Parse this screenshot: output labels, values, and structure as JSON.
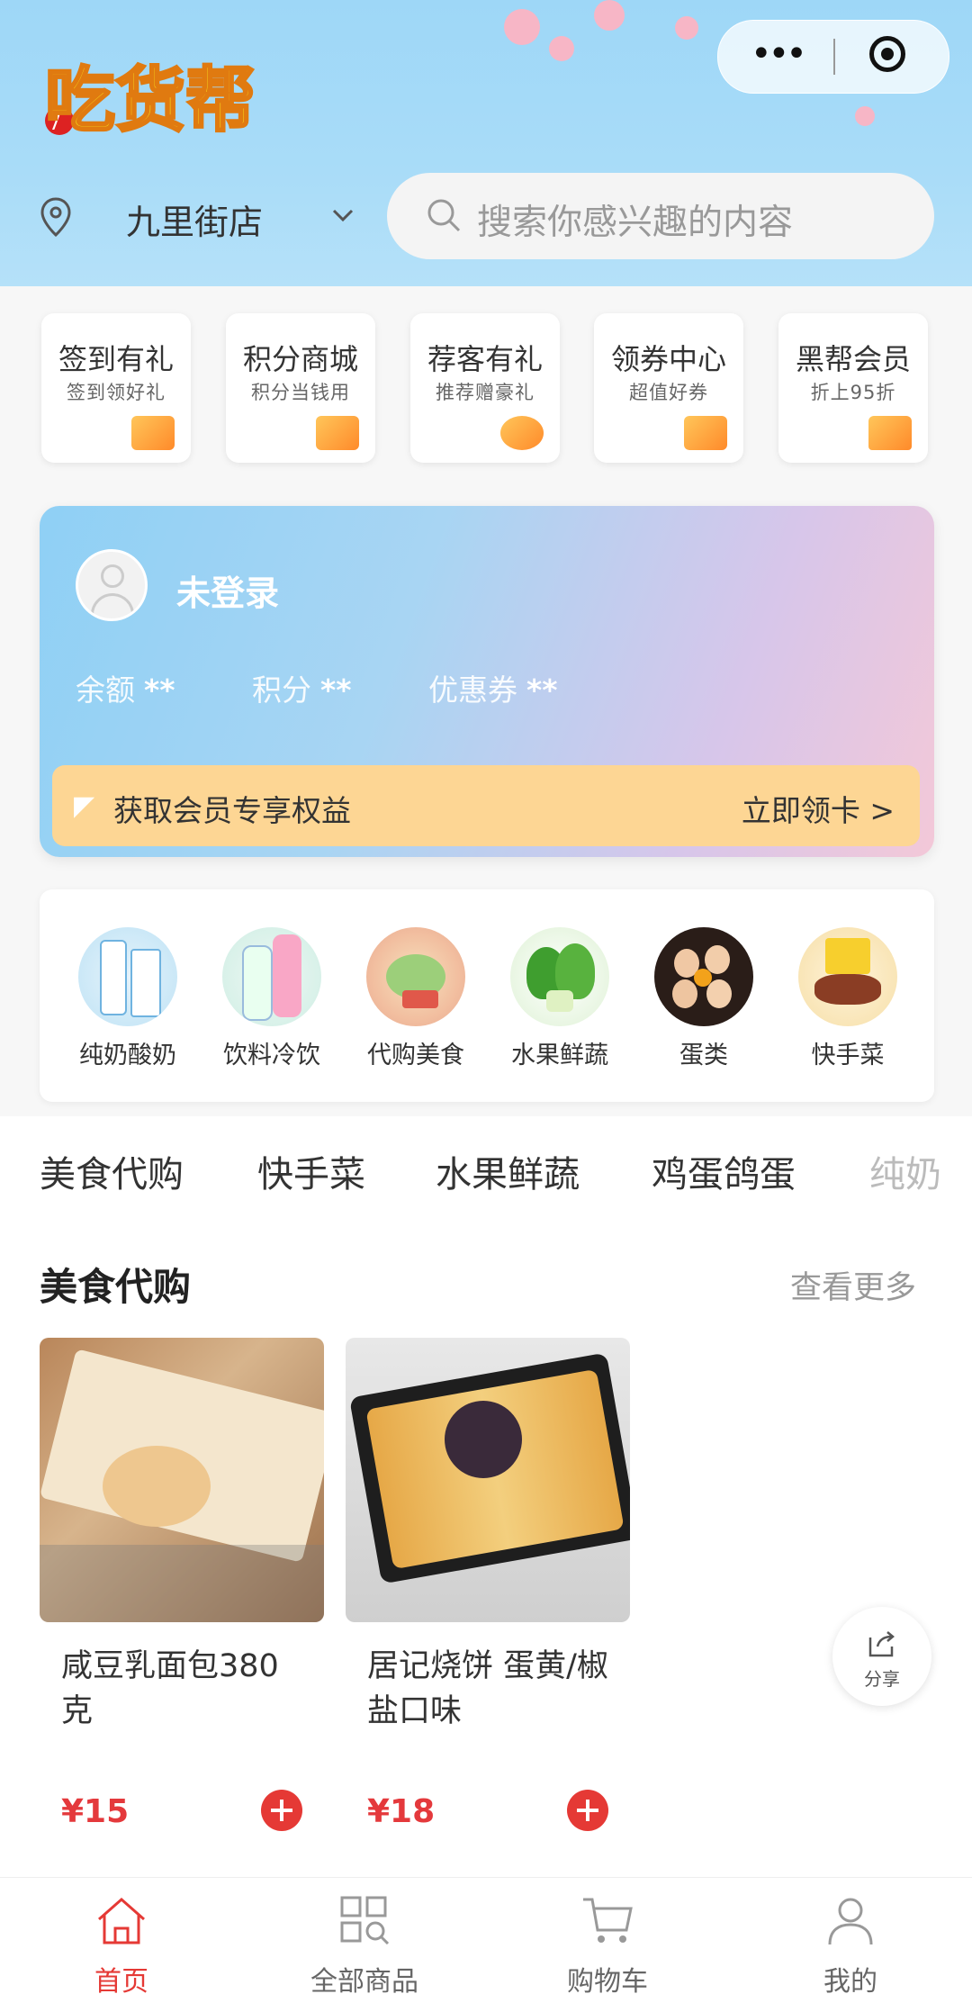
{
  "header": {
    "logo_text": "吃货帮",
    "store_name": "九里街店",
    "search_placeholder": "搜索你感兴趣的内容"
  },
  "quick_entries": [
    {
      "title": "签到有礼",
      "subtitle": "签到领好礼",
      "icon": "calendar-check-icon"
    },
    {
      "title": "积分商城",
      "subtitle": "积分当钱用",
      "icon": "store-icon"
    },
    {
      "title": "荐客有礼",
      "subtitle": "推荐赠豪礼",
      "icon": "user-add-icon"
    },
    {
      "title": "领券中心",
      "subtitle": "超值好券",
      "icon": "coupon-icon"
    },
    {
      "title": "黑帮会员",
      "subtitle": "折上95折",
      "icon": "crown-icon"
    }
  ],
  "member": {
    "login_status": "未登录",
    "balance_label": "余额",
    "balance_value": "**",
    "points_label": "积分",
    "points_value": "**",
    "coupons_label": "优惠券",
    "coupons_value": "**",
    "promo_text": "获取会员专享权益",
    "promo_button": "立即领卡 >"
  },
  "categories": [
    {
      "label": "纯奶酸奶",
      "icon": "milk-icon"
    },
    {
      "label": "饮料冷饮",
      "icon": "drinks-icon"
    },
    {
      "label": "代购美食",
      "icon": "snacks-icon"
    },
    {
      "label": "水果鲜蔬",
      "icon": "vegetable-icon"
    },
    {
      "label": "蛋类",
      "icon": "eggs-icon"
    },
    {
      "label": "快手菜",
      "icon": "quick-dish-icon"
    }
  ],
  "tabs": [
    "美食代购",
    "快手菜",
    "水果鲜蔬",
    "鸡蛋鸽蛋",
    "纯奶"
  ],
  "section": {
    "title": "美食代购",
    "more": "查看更多",
    "products": [
      {
        "name": "咸豆乳面包380克",
        "price": "¥15"
      },
      {
        "name": "居记烧饼 蛋黄/椒盐口味",
        "price": "¥18"
      }
    ]
  },
  "share_label": "分享",
  "tabbar": [
    {
      "label": "首页",
      "icon": "home-icon",
      "active": true
    },
    {
      "label": "全部商品",
      "icon": "grid-search-icon",
      "active": false
    },
    {
      "label": "购物车",
      "icon": "cart-icon",
      "active": false
    },
    {
      "label": "我的",
      "icon": "user-icon",
      "active": false
    }
  ],
  "colors": {
    "accent": "#e53935",
    "header_bg": "#a9dcf8",
    "promo_bar": "#fdd694"
  }
}
